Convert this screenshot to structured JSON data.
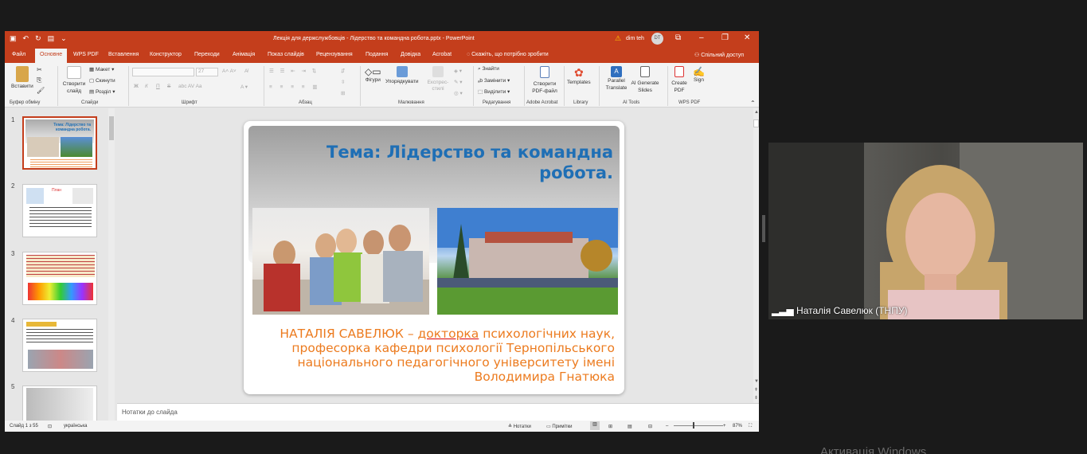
{
  "titlebar": {
    "doc_title": "Лекція для держслужбовців - Лідерство та командна робота.pptx  -  PowerPoint",
    "user": "dim teh",
    "avatar_initials": "DT"
  },
  "tabs": [
    "Файл",
    "Основне",
    "WPS PDF",
    "Вставлення",
    "Конструктор",
    "Переходи",
    "Анімація",
    "Показ слайдів",
    "Рецензування",
    "Подання",
    "Довідка",
    "Acrobat"
  ],
  "tell_me": "Скажіть, що потрібно зробити",
  "share": "Спільний доступ",
  "ribbon": {
    "paste": "Вставити",
    "clipboard_group": "Буфер обміну",
    "new_slide": "Створити слайд",
    "layout": "Макет",
    "reset": "Скинути",
    "section": "Розділ",
    "slides_group": "Слайди",
    "font_size": "27",
    "font_group": "Шрифт",
    "bold": "Ж",
    "italic": "К",
    "underline": "П",
    "strike": "S",
    "paragraph_group": "Абзац",
    "shapes": "Фігури",
    "arrange": "Упорядкувати",
    "quick_styles": "Експрес-стилі",
    "drawing_group": "Малювання",
    "find": "Знайти",
    "replace": "Замінити",
    "select": "Виділити",
    "editing_group": "Редагування",
    "create_pdf_file": "Створити PDF-файл",
    "adobe_group": "Adobe Acrobat",
    "templates": "Templates",
    "library_group": "Library",
    "parallel": "Parallel Translate",
    "ai_generate": "AI Generate Slides",
    "ai_group": "AI Tools",
    "create_pdf": "Create PDF",
    "sign": "Sign",
    "wps_group": "WPS PDF"
  },
  "thumbnails": [
    {
      "num": "1",
      "title": "Тема: Лідерство та командна робота."
    },
    {
      "num": "2",
      "title": "План"
    },
    {
      "num": "3",
      "title": ""
    },
    {
      "num": "4",
      "title": ""
    },
    {
      "num": "5",
      "title": ""
    }
  ],
  "slide": {
    "title": "Тема: Лідерство та командна робота.",
    "author_name": "НАТАЛІЯ САВЕЛЮК – ",
    "author_underlined": "докторка",
    "author_rest": " психологічних наук, професорка кафедри психології Тернопільського національного педагогічного університету імені Володимира Гнатюка"
  },
  "notes_placeholder": "Нотатки до слайда",
  "status": {
    "slide_counter": "Слайд 1 з 55",
    "language": "українська",
    "notes": "Нотатки",
    "comments": "Примітки",
    "zoom": "87%"
  },
  "webcam": {
    "participant": "Наталія Савелюк (ТНПУ)"
  },
  "watermark": "Активація Windows",
  "colors": {
    "accent": "#c43e1c",
    "title_blue": "#1f6fb5",
    "author_orange": "#ec7b1f"
  }
}
